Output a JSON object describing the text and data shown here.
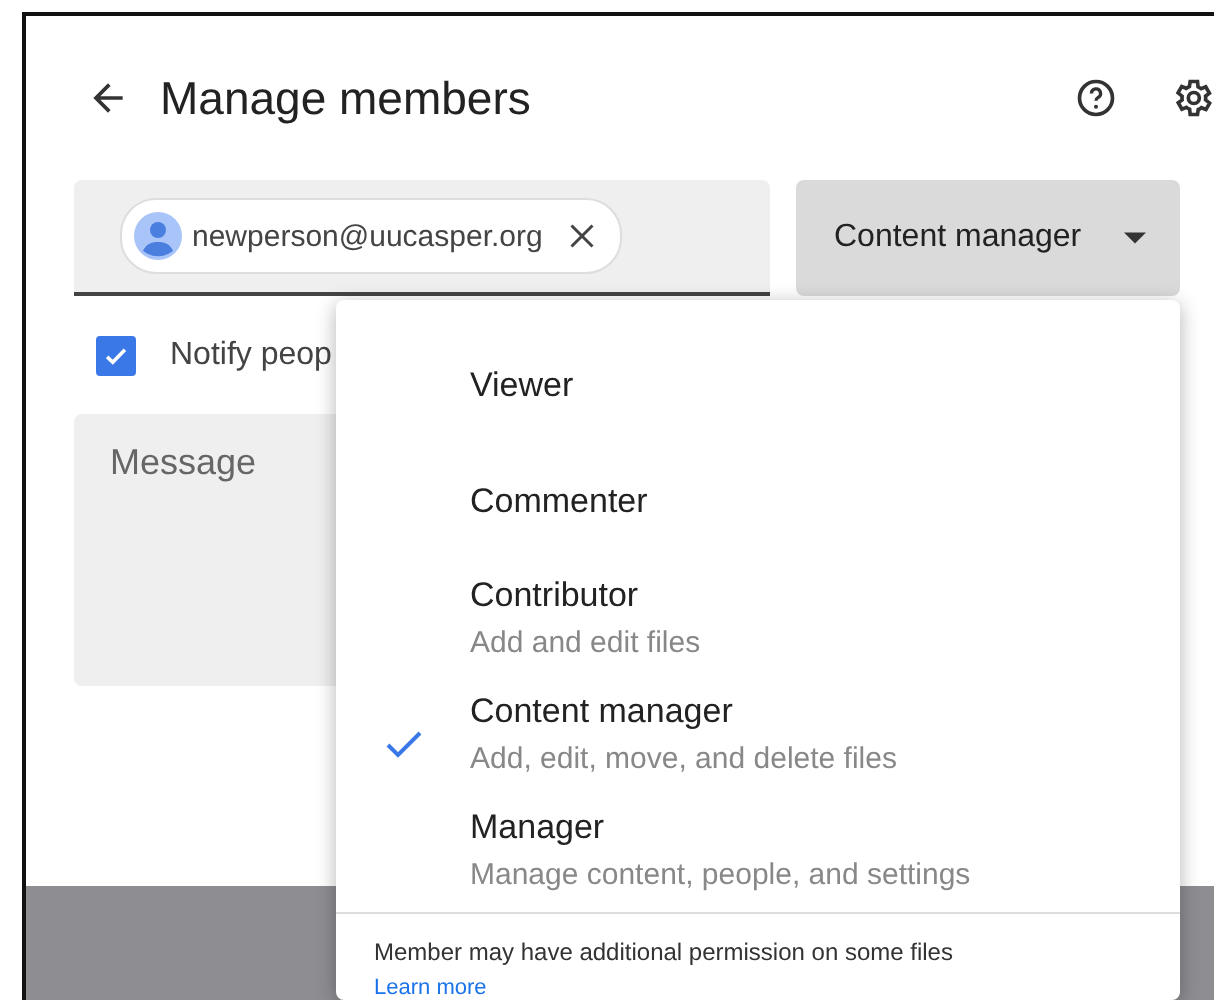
{
  "dialog": {
    "title": "Manage members",
    "recipient_chip": {
      "email": "newperson@uucasper.org"
    },
    "role_dropdown": {
      "value": "Content manager"
    },
    "notify": {
      "label": "Notify peop",
      "checked": true
    },
    "message": {
      "placeholder": "Message"
    }
  },
  "role_menu": {
    "items": [
      {
        "label": "Viewer",
        "selected": false
      },
      {
        "label": "Commenter",
        "selected": false
      },
      {
        "label": "Contributor",
        "description": "Add and edit files",
        "selected": false
      },
      {
        "label": "Content manager",
        "description": "Add, edit, move, and delete files",
        "selected": true
      },
      {
        "label": "Manager",
        "description": "Manage content, people, and settings",
        "selected": false
      }
    ],
    "footer": {
      "note": "Member may have additional permission on some files",
      "link": "Learn more"
    }
  }
}
